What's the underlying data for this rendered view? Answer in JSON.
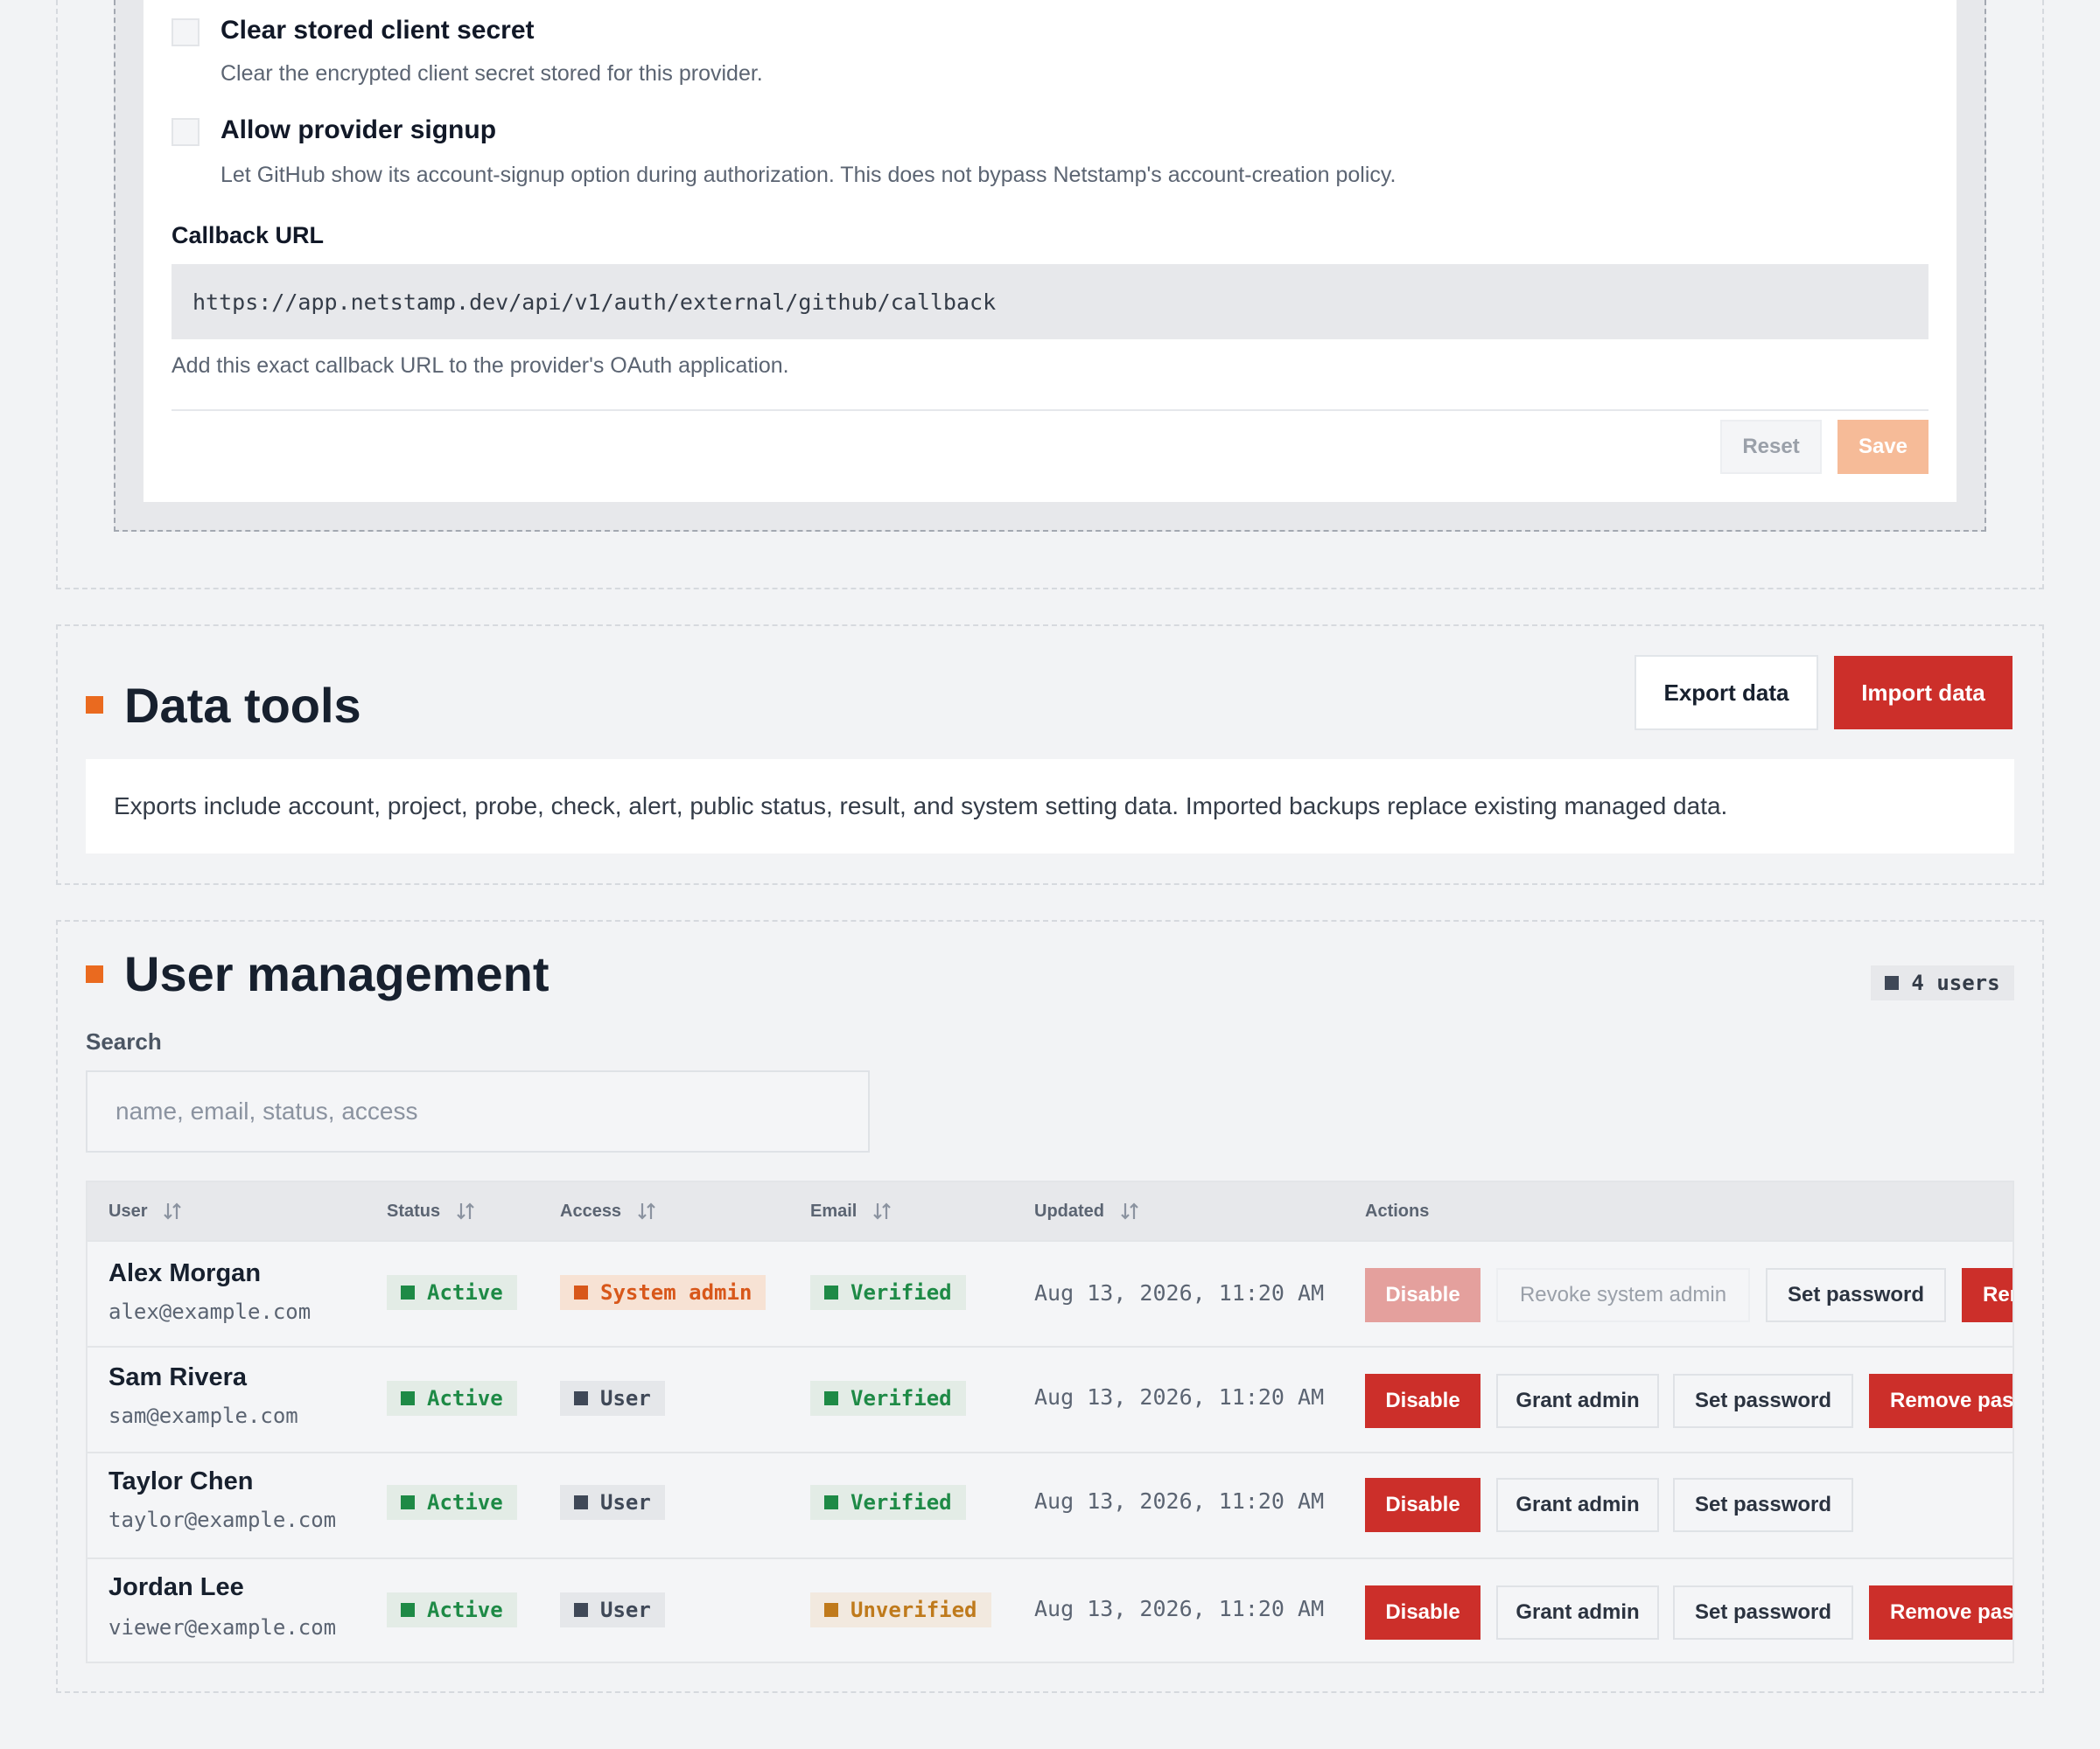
{
  "provider": {
    "options": [
      {
        "title": "Clear stored client secret",
        "description": "Clear the encrypted client secret stored for this provider."
      },
      {
        "title": "Allow provider signup",
        "description": "Let GitHub show its account-signup option during authorization. This does not bypass Netstamp's account-creation policy."
      }
    ],
    "callback_label": "Callback URL",
    "callback_url": "https://app.netstamp.dev/api/v1/auth/external/github/callback",
    "callback_help": "Add this exact callback URL to the provider's OAuth application.",
    "reset_label": "Reset",
    "save_label": "Save"
  },
  "data_tools": {
    "title": "Data tools",
    "export_label": "Export data",
    "import_label": "Import data",
    "description": "Exports include account, project, probe, check, alert, public status, result, and system setting data. Imported backups replace existing managed data."
  },
  "user_management": {
    "title": "User management",
    "count": "4 users",
    "search_label": "Search",
    "search_placeholder": "name, email, status, access",
    "search_value": "",
    "columns": [
      "User",
      "Status",
      "Access",
      "Email",
      "Updated",
      "Actions"
    ],
    "rows": [
      {
        "name": "Alex Morgan",
        "email": "alex@example.com",
        "status": "Active",
        "access": "System admin",
        "email_status": "Verified",
        "updated": "Aug 13, 2026, 11:20 AM",
        "actions": [
          "Disable",
          "Revoke system admin",
          "Set password",
          "Remove password"
        ]
      },
      {
        "name": "Sam Rivera",
        "email": "sam@example.com",
        "status": "Active",
        "access": "User",
        "email_status": "Verified",
        "updated": "Aug 13, 2026, 11:20 AM",
        "actions": [
          "Disable",
          "Grant admin",
          "Set password",
          "Remove password"
        ]
      },
      {
        "name": "Taylor Chen",
        "email": "taylor@example.com",
        "status": "Active",
        "access": "User",
        "email_status": "Verified",
        "updated": "Aug 13, 2026, 11:20 AM",
        "actions": [
          "Disable",
          "Grant admin",
          "Set password"
        ]
      },
      {
        "name": "Jordan Lee",
        "email": "viewer@example.com",
        "status": "Active",
        "access": "User",
        "email_status": "Unverified",
        "updated": "Aug 13, 2026, 11:20 AM",
        "actions": [
          "Disable",
          "Grant admin",
          "Set password",
          "Remove password"
        ]
      }
    ]
  },
  "colors": {
    "accent": "#ea6a1f",
    "danger": "#cc2f2a",
    "success": "#1e8a46",
    "warning": "#bf7a1c",
    "page_background": "#f2f3f5"
  },
  "icons": [
    "sort-icon",
    "checkbox-icon",
    "status-square-icon"
  ]
}
